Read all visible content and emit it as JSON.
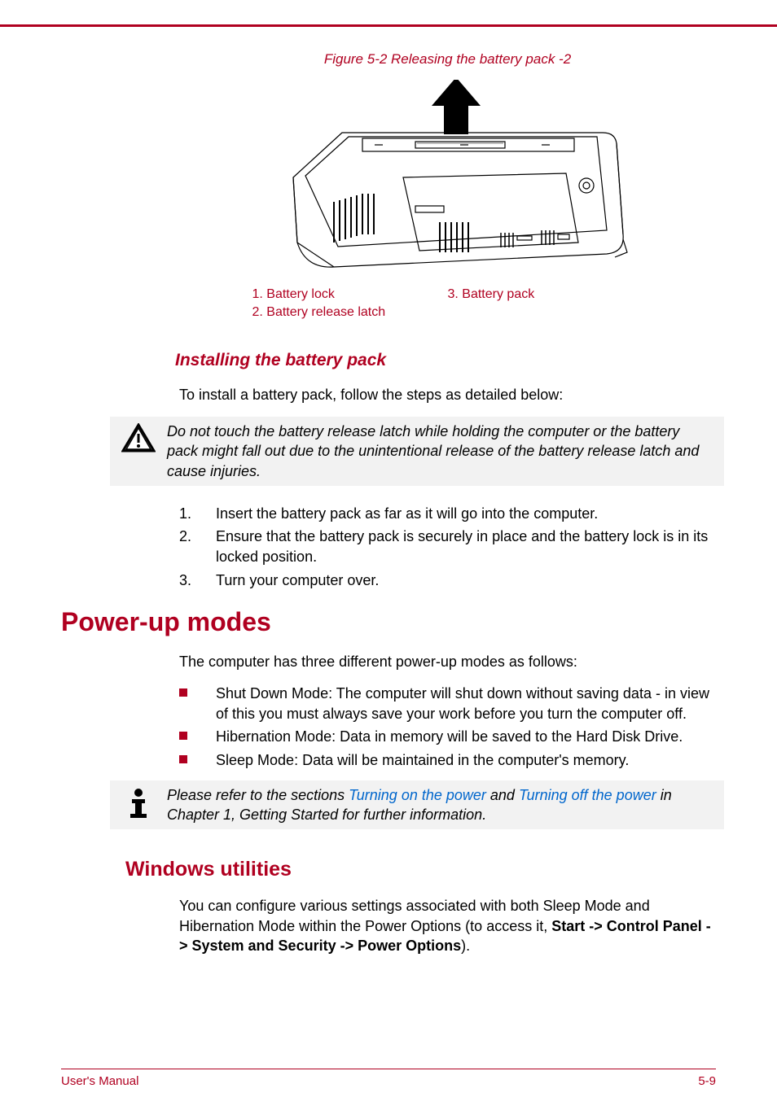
{
  "figure": {
    "caption": "Figure 5-2 Releasing the battery pack -2",
    "legend": {
      "col1": [
        "1. Battery lock",
        "2. Battery release latch"
      ],
      "col2": [
        "3. Battery pack"
      ]
    }
  },
  "section_install": {
    "heading": "Installing the battery pack",
    "intro": "To install a battery pack, follow the steps as detailed below:",
    "warning": "Do not touch the battery release latch while holding the computer or the battery pack might fall out due to the unintentional release of the battery release latch and cause injuries.",
    "steps": [
      {
        "n": "1.",
        "t": "Insert the battery pack as far as it will go into the computer."
      },
      {
        "n": "2.",
        "t": "Ensure that the battery pack is securely in place and the battery lock is in its locked position."
      },
      {
        "n": "3.",
        "t": "Turn your computer over."
      }
    ]
  },
  "section_power": {
    "heading": "Power-up modes",
    "intro": "The computer has three different power-up modes as follows:",
    "bullets": [
      "Shut Down Mode: The computer will shut down without saving data - in view of this you must always save your work before you turn the computer off.",
      "Hibernation Mode: Data in memory will be saved to the Hard Disk Drive.",
      "Sleep Mode: Data will be maintained in the computer's memory."
    ],
    "note_pre": "Please refer to the sections ",
    "note_link1": "Turning on the power",
    "note_mid": " and ",
    "note_link2": "Turning off the power",
    "note_post": " in Chapter 1, Getting Started for further information."
  },
  "section_windows": {
    "heading": "Windows utilities",
    "para_pre": "You can configure various settings associated with both Sleep Mode and Hibernation Mode within the Power Options (to access it, ",
    "para_bold": "Start -> Control Panel -> System and Security -> Power Options",
    "para_post": ")."
  },
  "footer": {
    "left": "User's Manual",
    "right": "5-9"
  }
}
